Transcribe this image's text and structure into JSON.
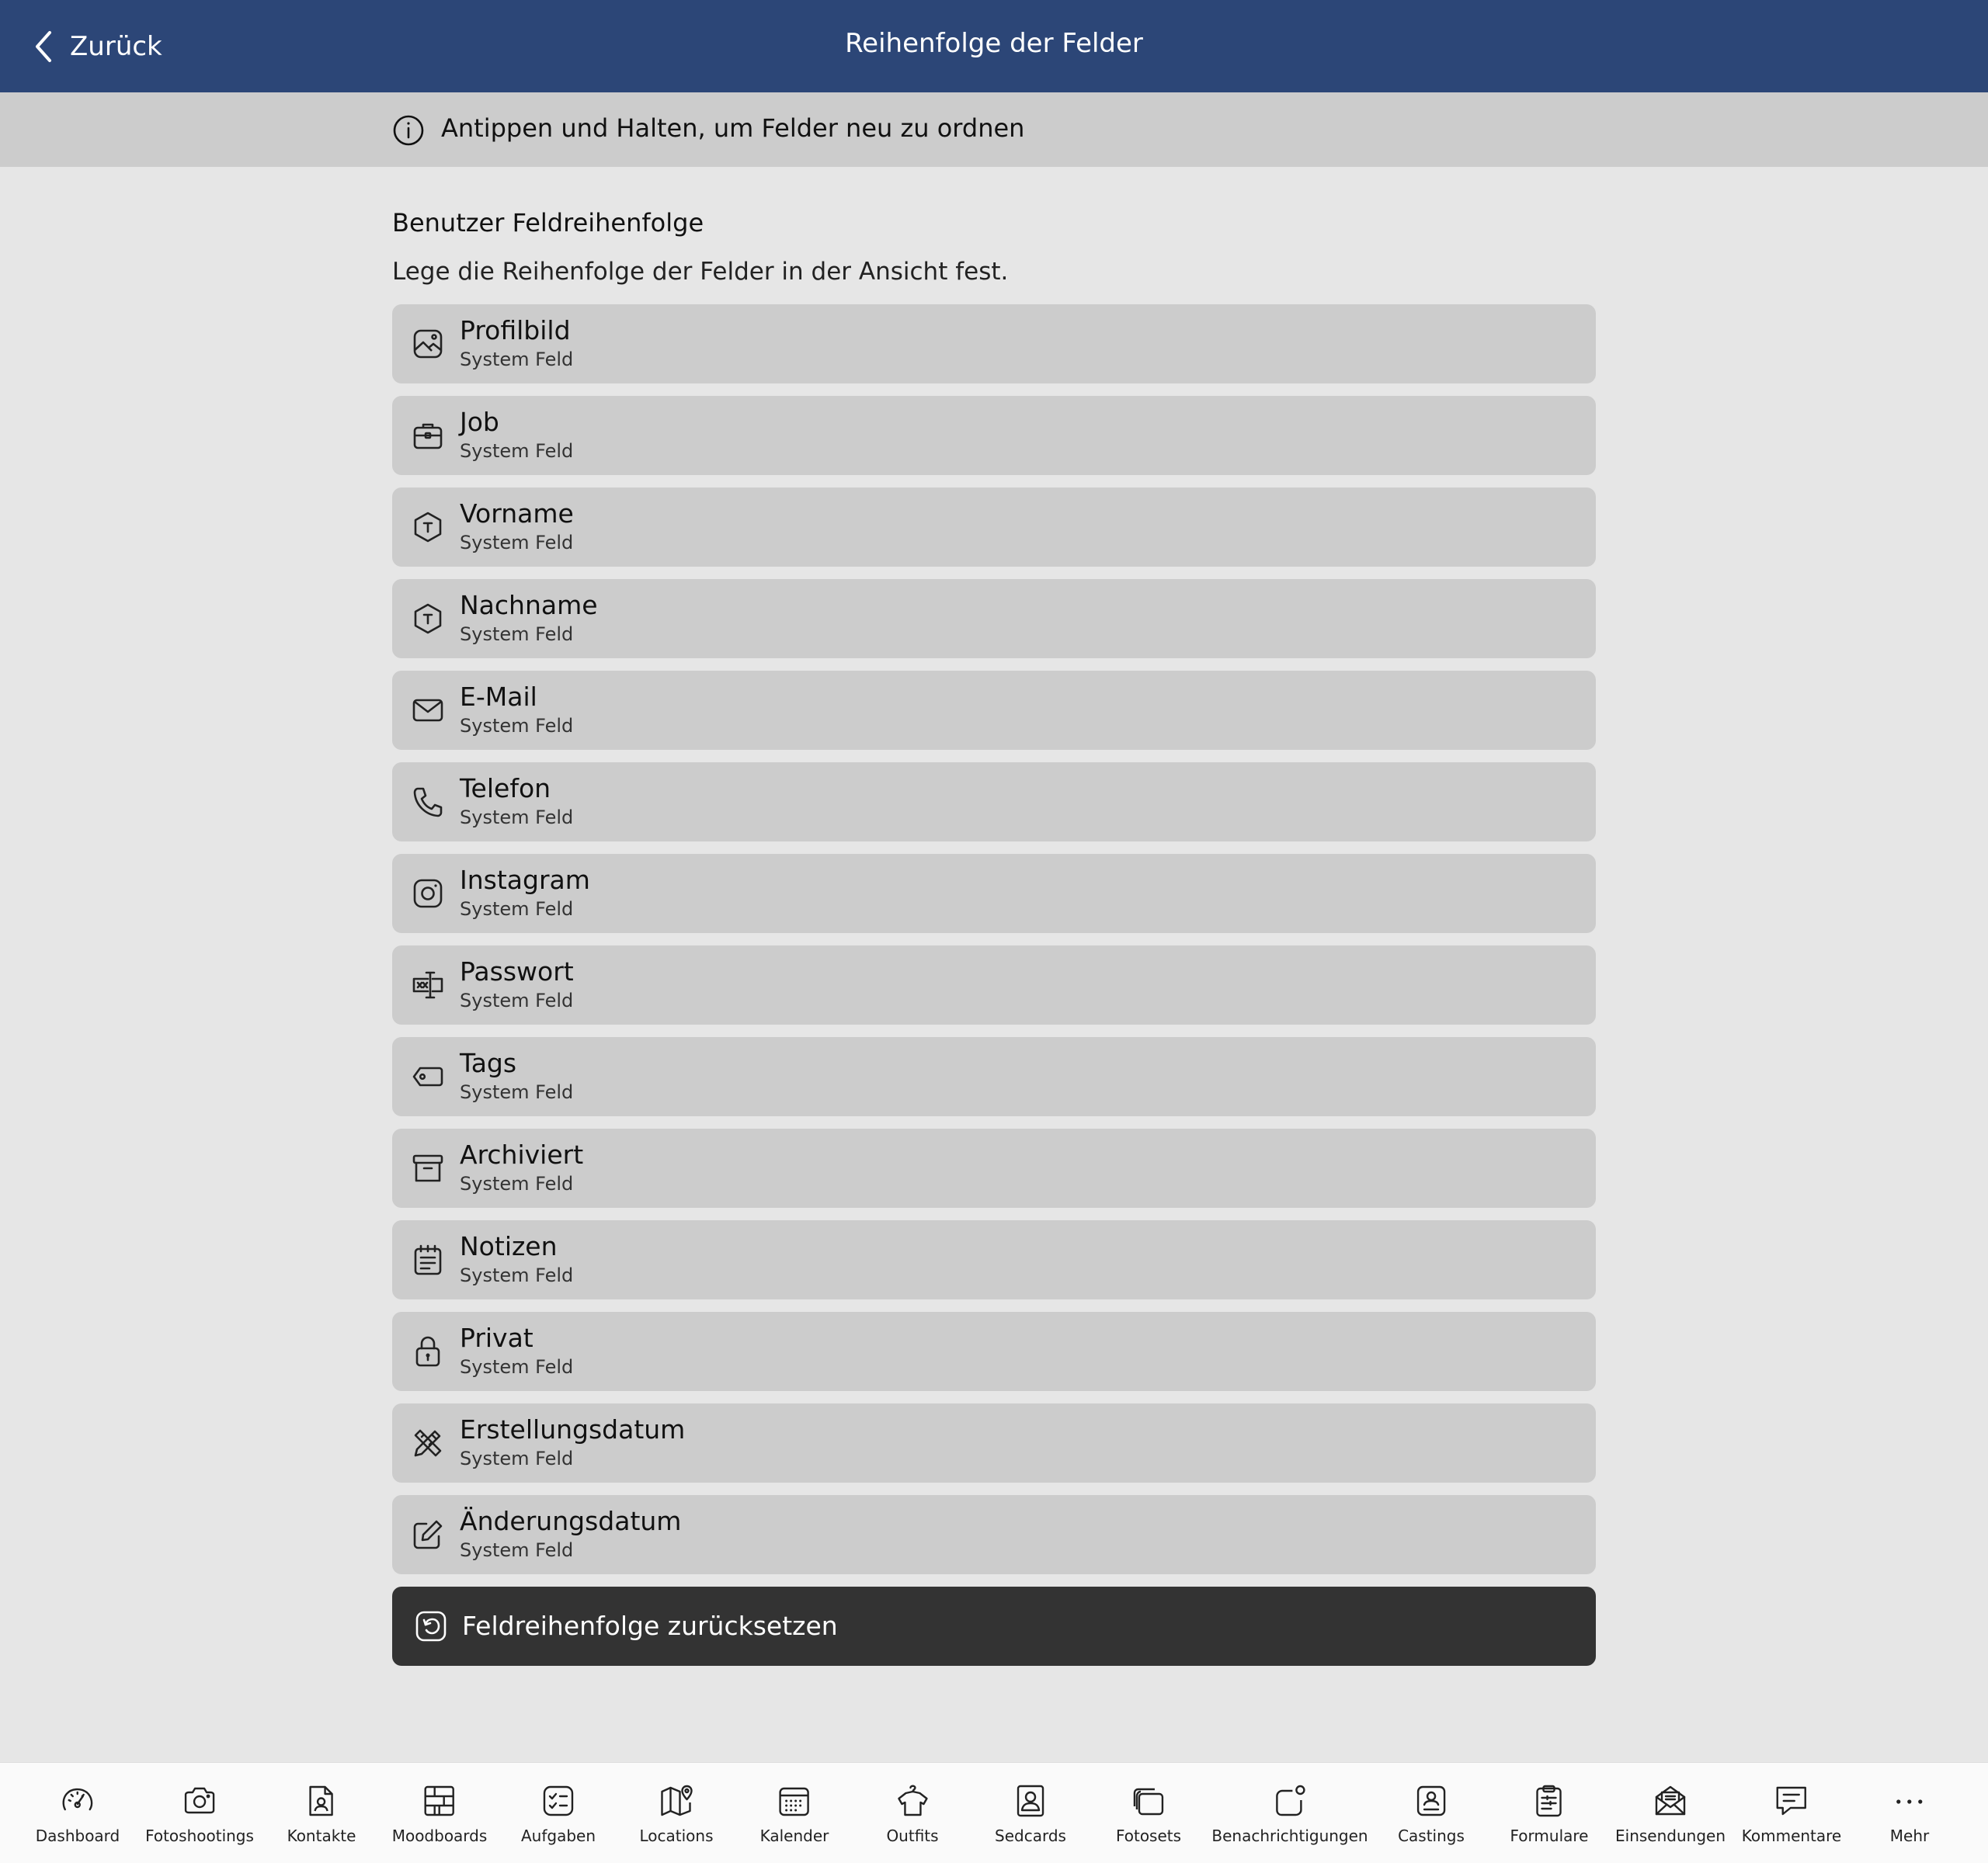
{
  "header": {
    "back_label": "Zurück",
    "title": "Reihenfolge der Felder",
    "color": "#2c4677"
  },
  "hint": {
    "text": "Antippen und Halten, um Felder neu zu ordnen",
    "icon": "info-icon"
  },
  "section": {
    "title": "Benutzer Feldreihenfolge",
    "description": "Lege die Reihenfolge der Felder in der Ansicht fest."
  },
  "fields": [
    {
      "label": "Profilbild",
      "sub": "System Feld",
      "icon": "image-icon"
    },
    {
      "label": "Job",
      "sub": "System Feld",
      "icon": "briefcase-icon"
    },
    {
      "label": "Vorname",
      "sub": "System Feld",
      "icon": "text-hexagon-icon"
    },
    {
      "label": "Nachname",
      "sub": "System Feld",
      "icon": "text-hexagon-icon"
    },
    {
      "label": "E-Mail",
      "sub": "System Feld",
      "icon": "mail-icon"
    },
    {
      "label": "Telefon",
      "sub": "System Feld",
      "icon": "phone-icon"
    },
    {
      "label": "Instagram",
      "sub": "System Feld",
      "icon": "instagram-icon"
    },
    {
      "label": "Passwort",
      "sub": "System Feld",
      "icon": "password-icon"
    },
    {
      "label": "Tags",
      "sub": "System Feld",
      "icon": "tag-icon"
    },
    {
      "label": "Archiviert",
      "sub": "System Feld",
      "icon": "archive-icon"
    },
    {
      "label": "Notizen",
      "sub": "System Feld",
      "icon": "notes-icon"
    },
    {
      "label": "Privat",
      "sub": "System Feld",
      "icon": "lock-icon"
    },
    {
      "label": "Erstellungsdatum",
      "sub": "System Feld",
      "icon": "pencil-ruler-icon"
    },
    {
      "label": "Änderungsdatum",
      "sub": "System Feld",
      "icon": "edit-icon"
    }
  ],
  "reset": {
    "label": "Feldreihenfolge zurücksetzen",
    "icon": "reset-icon"
  },
  "nav": [
    {
      "label": "Dashboard",
      "icon": "gauge-icon"
    },
    {
      "label": "Fotoshootings",
      "icon": "camera-icon"
    },
    {
      "label": "Kontakte",
      "icon": "contact-file-icon"
    },
    {
      "label": "Moodboards",
      "icon": "moodboard-icon"
    },
    {
      "label": "Aufgaben",
      "icon": "tasks-icon"
    },
    {
      "label": "Locations",
      "icon": "map-icon"
    },
    {
      "label": "Kalender",
      "icon": "calendar-icon"
    },
    {
      "label": "Outfits",
      "icon": "hanger-icon"
    },
    {
      "label": "Sedcards",
      "icon": "portrait-card-icon"
    },
    {
      "label": "Fotosets",
      "icon": "photo-stack-icon"
    },
    {
      "label": "Benachrichtigungen",
      "icon": "notification-icon"
    },
    {
      "label": "Castings",
      "icon": "casting-icon"
    },
    {
      "label": "Formulare",
      "icon": "clipboard-icon"
    },
    {
      "label": "Einsendungen",
      "icon": "open-mail-icon"
    },
    {
      "label": "Kommentare",
      "icon": "comment-icon"
    },
    {
      "label": "Mehr",
      "icon": "more-icon"
    }
  ]
}
